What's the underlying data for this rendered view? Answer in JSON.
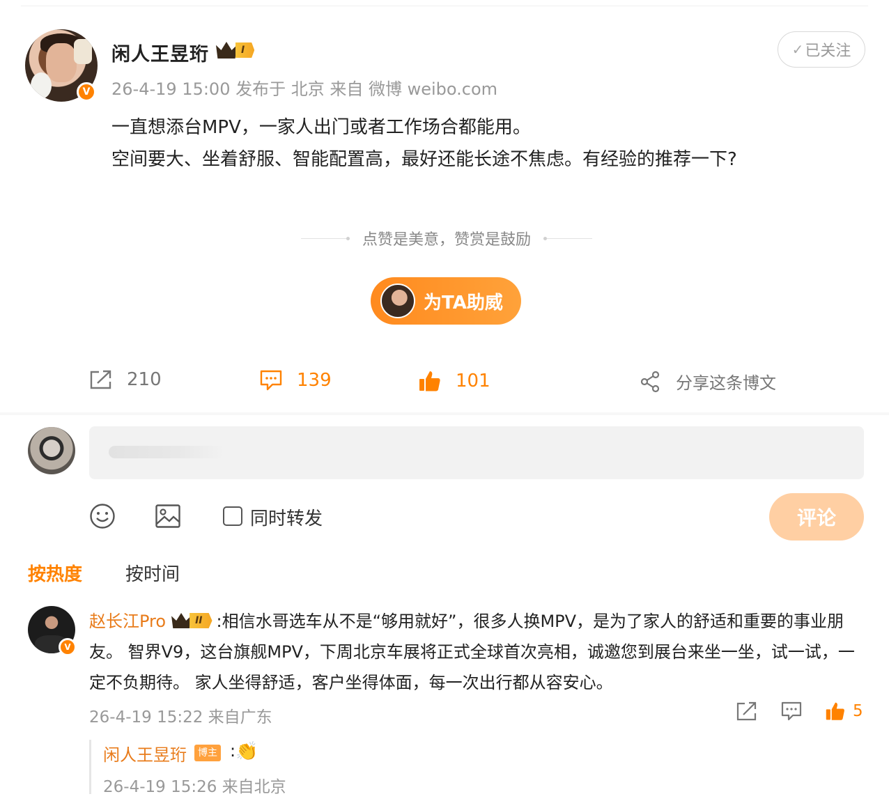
{
  "post": {
    "author": "闲人王昱珩",
    "level_tag": "I",
    "follow_label": "已关注",
    "meta": "26-4-19 15:00  发布于 北京  来自 微博 weibo.com",
    "text_line1": "一直想添台MPV，一家人出门或者工作场合都能用。",
    "text_line2": "空间要大、坐着舒服、智能配置高，最好还能长途不焦虑。有经验的推荐一下?",
    "tip_text": "点赞是美意，赞赏是鼓励",
    "cheer_label": "为TA助威",
    "reposts": "210",
    "comments": "139",
    "likes": "101",
    "share_label": "分享这条博文"
  },
  "composer": {
    "placeholder": "",
    "forward_label": "同时转发",
    "submit_label": "评论"
  },
  "sort": {
    "hot": "按热度",
    "time": "按时间"
  },
  "comment": {
    "author": "赵长江Pro",
    "level_tag": "II",
    "text": ":相信水哥选车从不是“够用就好”，很多人换MPV，是为了家人的舒适和重要的事业朋友。 智界V9，这台旗舰MPV，下周北京车展将正式全球首次亮相，诚邀您到展台来坐一坐，试一试，一定不负期待。 家人坐得舒适，客户坐得体面，每一次出行都从容安心。",
    "meta": "26-4-19 15:22 来自广东",
    "likes": "5"
  },
  "reply": {
    "author": "闲人王昱珩",
    "badge": "博主",
    "colon": ":",
    "emoji": "👏",
    "meta": "26-4-19 15:26 来自北京"
  },
  "colors": {
    "accent": "#ff8200",
    "name_orange": "#e87b1a",
    "submit_disabled": "#ffcfa3"
  },
  "icons": [
    "repost-icon",
    "comment-icon",
    "like-icon",
    "share-icon",
    "emoji-icon",
    "image-icon",
    "verified-icon",
    "crown-icon"
  ]
}
